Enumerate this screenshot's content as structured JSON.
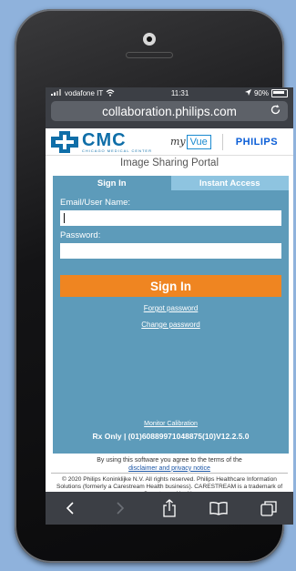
{
  "status_bar": {
    "carrier": "vodafone IT",
    "time": "11:31",
    "battery_percent": "90%"
  },
  "browser": {
    "url": "collaboration.philips.com"
  },
  "branding": {
    "cmc_logo_text": "CMC",
    "cmc_logo_subtitle": "CHICAGO MEDICAL CENTER",
    "myvue_my": "my",
    "myvue_vue": "Vue",
    "philips": "PHILIPS"
  },
  "portal_title": "Image Sharing Portal",
  "tabs": [
    {
      "label": "Sign In",
      "active": true
    },
    {
      "label": "Instant Access",
      "active": false
    }
  ],
  "form": {
    "email_label": "Email/User Name:",
    "email_value": "",
    "password_label": "Password:",
    "password_value": "",
    "signin_label": "Sign In"
  },
  "links": {
    "forgot_password": "Forgot password",
    "change_password": "Change password",
    "monitor_calibration": "Monitor Calibration"
  },
  "rx_line": "Rx Only | (01)60889971048875(10)V12.2.5.0",
  "terms": {
    "text": "By using this software you agree to the terms of the",
    "link": "disclaimer and privacy notice"
  },
  "copyright": "© 2020 Philips Koninklijke N.V. All rights reserved. Philips Healthcare Information Solutions (formerly a Carestream Health business). CARESTREAM is a trademark of Carestream Health.",
  "colors": {
    "panel": "#5d9bba",
    "tab_inactive": "#8ec4e0",
    "signin_button": "#ef8521",
    "browser_chrome": "#3c3f45"
  }
}
